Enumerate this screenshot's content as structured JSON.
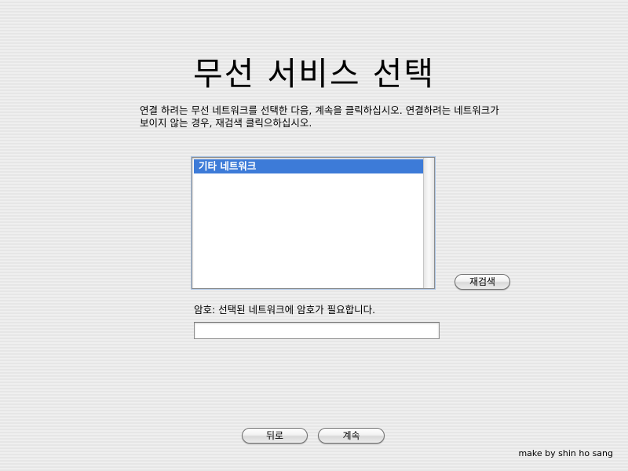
{
  "page": {
    "title": "무선 서비스 선택",
    "instructions": "연결 하려는 무선 네트워크를 선택한 다음, 계속을 클릭하십시오. 연결하려는 네트워크가 보이지 않는 경우, 재검색 클릭으하십시오."
  },
  "network_list": {
    "items": [
      {
        "label": "기타 네트워크",
        "selected": true
      }
    ]
  },
  "rescan_button": {
    "label": "재검색"
  },
  "password": {
    "label": "암호: 선택된 네트워크에 암호가 필요합니다.",
    "value": "",
    "placeholder": ""
  },
  "navigation": {
    "back_label": "뒤로",
    "continue_label": "계속"
  },
  "credit": "make by shin ho sang",
  "colors": {
    "selection": "#3d7bd8",
    "background": "#ececec"
  }
}
